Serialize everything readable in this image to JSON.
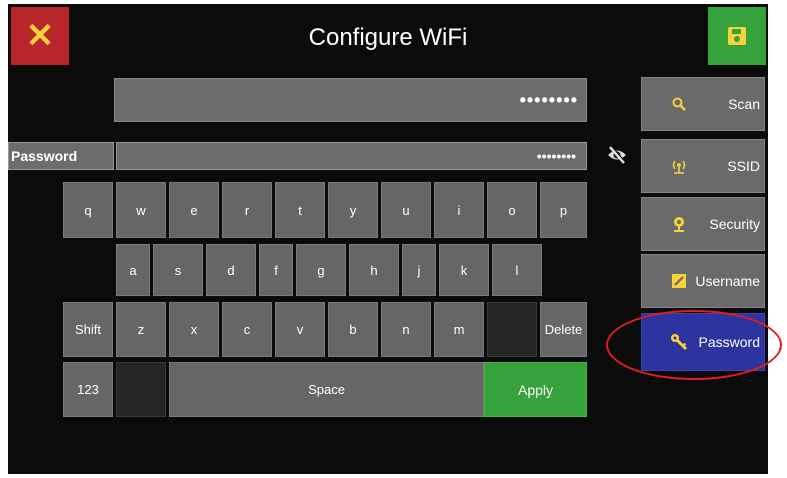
{
  "header": {
    "title": "Configure WiFi",
    "close_icon": "close-icon",
    "save_icon": "floppy-disk-icon"
  },
  "ssid_field": {
    "value": "••••••••"
  },
  "password_field": {
    "label": "Password",
    "value": "••••••••",
    "toggle_icon": "eye-slash-icon"
  },
  "keyboard": {
    "row1": [
      "q",
      "w",
      "e",
      "r",
      "t",
      "y",
      "u",
      "i",
      "o",
      "p"
    ],
    "row2": [
      "a",
      "s",
      "d",
      "f",
      "g",
      "h",
      "j",
      "k",
      "l"
    ],
    "row3": [
      "Shift",
      "z",
      "x",
      "c",
      "v",
      "b",
      "n",
      "m",
      "",
      "Delete"
    ],
    "row4": {
      "mode": "123",
      "space": "Space",
      "apply": "Apply"
    }
  },
  "sidebar": {
    "items": [
      {
        "label": "Scan",
        "icon": "search-icon",
        "active": false
      },
      {
        "label": "SSID",
        "icon": "wifi-signal-icon",
        "active": false
      },
      {
        "label": "Security",
        "icon": "shield-icon",
        "active": false
      },
      {
        "label": "Username",
        "icon": "edit-icon",
        "active": false
      },
      {
        "label": "Password",
        "icon": "key-icon",
        "active": true
      }
    ]
  },
  "colors": {
    "background": "#0b0b0b",
    "close": "#b8262c",
    "save": "#36a23b",
    "apply": "#36a23b",
    "active_sidebar": "#2d34a0",
    "icon_yellow": "#f7d23b",
    "highlight": "#e11d1d"
  }
}
